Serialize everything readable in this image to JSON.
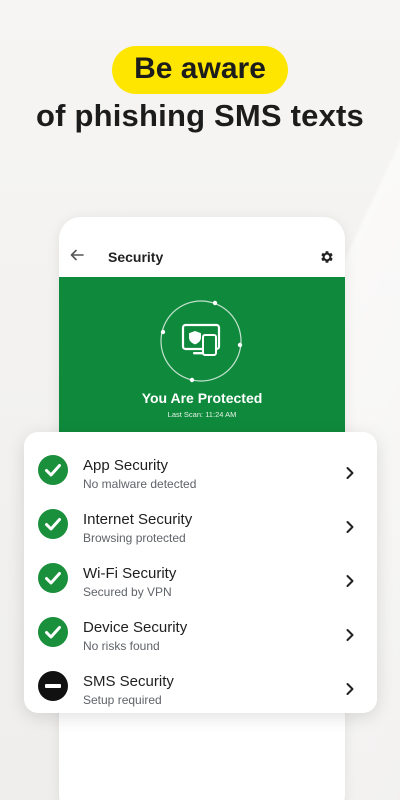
{
  "headline": {
    "highlight": "Be aware",
    "line2": "of phishing SMS texts"
  },
  "colors": {
    "highlight_yellow": "#ffe600",
    "brand_green": "#0f8a3c",
    "ok_green": "#1a8f3c",
    "blocked_black": "#111111"
  },
  "app": {
    "title": "Security",
    "back_icon": "arrow-left-icon",
    "settings_icon": "gear-icon",
    "status_title": "You Are Protected",
    "last_scan": "Last Scan: 11:24 AM",
    "hero_icon": "devices-shield-icon"
  },
  "items": [
    {
      "title": "App Security",
      "subtitle": "No malware detected",
      "status": "ok",
      "icon": "check-circle-icon"
    },
    {
      "title": "Internet Security",
      "subtitle": "Browsing protected",
      "status": "ok",
      "icon": "check-circle-icon"
    },
    {
      "title": "Wi-Fi Security",
      "subtitle": "Secured by VPN",
      "status": "ok",
      "icon": "check-circle-icon"
    },
    {
      "title": "Device Security",
      "subtitle": "No risks found",
      "status": "ok",
      "icon": "check-circle-icon"
    },
    {
      "title": "SMS Security",
      "subtitle": "Setup required",
      "status": "action",
      "icon": "minus-circle-icon"
    }
  ]
}
